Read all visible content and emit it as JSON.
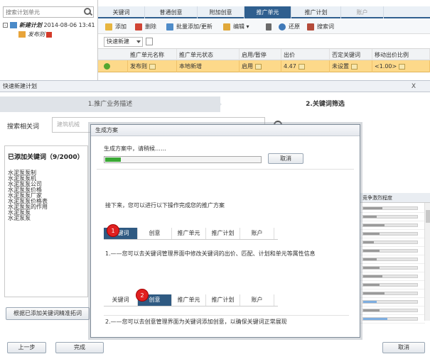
{
  "app": {
    "plan_search_placeholder": "搜索计划单元",
    "tree": {
      "plan_name": "新建计划",
      "plan_date": "2014-08-06 13:41",
      "unit_name": "发布则"
    },
    "tabs": [
      "关键词",
      "普通创意",
      "附加创意",
      "推广单元",
      "推广计划",
      "账户"
    ],
    "active_tab": "推广单元",
    "toolbar": {
      "add": "添加",
      "delete": "删除",
      "batch": "批量添加/更新",
      "edit": "编辑",
      "restore": "还原",
      "search_kw": "搜索词"
    },
    "quick_filter": "快速新建",
    "units_table": {
      "headers": [
        "推广单元名称",
        "推广单元状态",
        "启用/暂停",
        "出价",
        "否定关键词",
        "移动出价比例"
      ],
      "row": {
        "name": "发布则",
        "status": "本地新增",
        "enabled": "启用",
        "bid": "4.47",
        "negative": "未设置",
        "mobile_ratio": "<1.00>"
      }
    }
  },
  "wizard": {
    "title": "快速新建计划",
    "close_label": "X",
    "step1": "1.推广业务描述",
    "step2": "2.关键词筛选",
    "search_label": "搜索相关词",
    "search_placeholder": "建筑机械",
    "added_title": "已添加关键词（9/2000）",
    "added_keywords": [
      "水泥泵泵制",
      "水泥泵泵机",
      "水泥泵泵公司",
      "水泥泵泵价格",
      "水泥泵泵厂家",
      "水泥泵泵价格表",
      "水泥泵泵的作用",
      "水泥泵泵",
      "水泥泵泵"
    ],
    "grid_header": "竞争激烈程度",
    "grid_bars": [
      0.35,
      0.25,
      0.4,
      0.3,
      0.2,
      0.3,
      0.25,
      0.3,
      0.35,
      0.3,
      0.4,
      0.25,
      0.3,
      0.45
    ],
    "precise_btn": "根据已添加关键词精准拓词",
    "prev_btn": "上一步",
    "done_btn": "完成",
    "cancel_btn": "取消"
  },
  "dialog": {
    "title": "生成方案",
    "status": "生成方案中，请稍候……",
    "progress": 0.1,
    "cancel": "取消",
    "next_text": "接下来，您可以进行以下操作完成您的推广方案",
    "tabs": [
      "关键词",
      "创意",
      "推广单元",
      "推广计划",
      "账户"
    ],
    "section1_text": "1.——您可以去关键词管理界面中修改关键词的出价、匹配、计划和单元等属性信息",
    "section2_text": "2.——您可以去创意管理界面为关键词添加创意，以确保关键词正常展现",
    "markers": [
      "1",
      "2"
    ]
  }
}
